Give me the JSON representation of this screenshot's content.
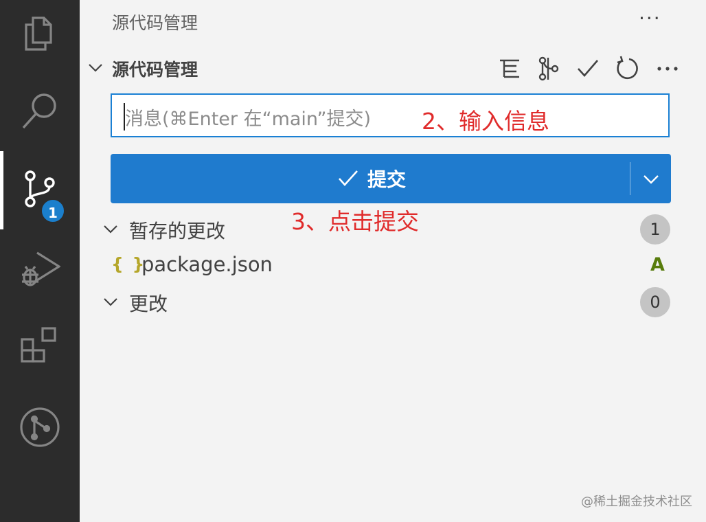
{
  "activity_bar": {
    "items": [
      {
        "name": "explorer",
        "icon": "files-icon"
      },
      {
        "name": "search",
        "icon": "search-icon"
      },
      {
        "name": "source-control",
        "icon": "source-control-icon",
        "badge": "1",
        "active": true
      },
      {
        "name": "run-debug",
        "icon": "run-debug-icon"
      },
      {
        "name": "extensions",
        "icon": "extensions-icon"
      },
      {
        "name": "git-graph",
        "icon": "git-graph-icon"
      }
    ]
  },
  "sidebar": {
    "title": "源代码管理",
    "more": "···"
  },
  "section": {
    "title": "源代码管理",
    "toolbar": [
      "tree-view-icon",
      "branch-compare-icon",
      "check-icon",
      "refresh-icon",
      "more-icon"
    ]
  },
  "commit": {
    "placeholder": "消息(⌘Enter 在“main”提交)",
    "button_label": "提交",
    "button_icon": "check-icon",
    "dropdown_icon": "chevron-down-icon",
    "button_color": "#1f7bce"
  },
  "annotations": {
    "input_note": "2、输入信息",
    "button_note": "3、点击提交",
    "color": "#e02b2b"
  },
  "groups": {
    "staged": {
      "label": "暂存的更改",
      "count": "1"
    },
    "changes": {
      "label": "更改",
      "count": "0"
    }
  },
  "files": [
    {
      "icon": "{ }",
      "name": "package.json",
      "status": "A"
    }
  ],
  "watermark": "@稀土掘金技术社区"
}
